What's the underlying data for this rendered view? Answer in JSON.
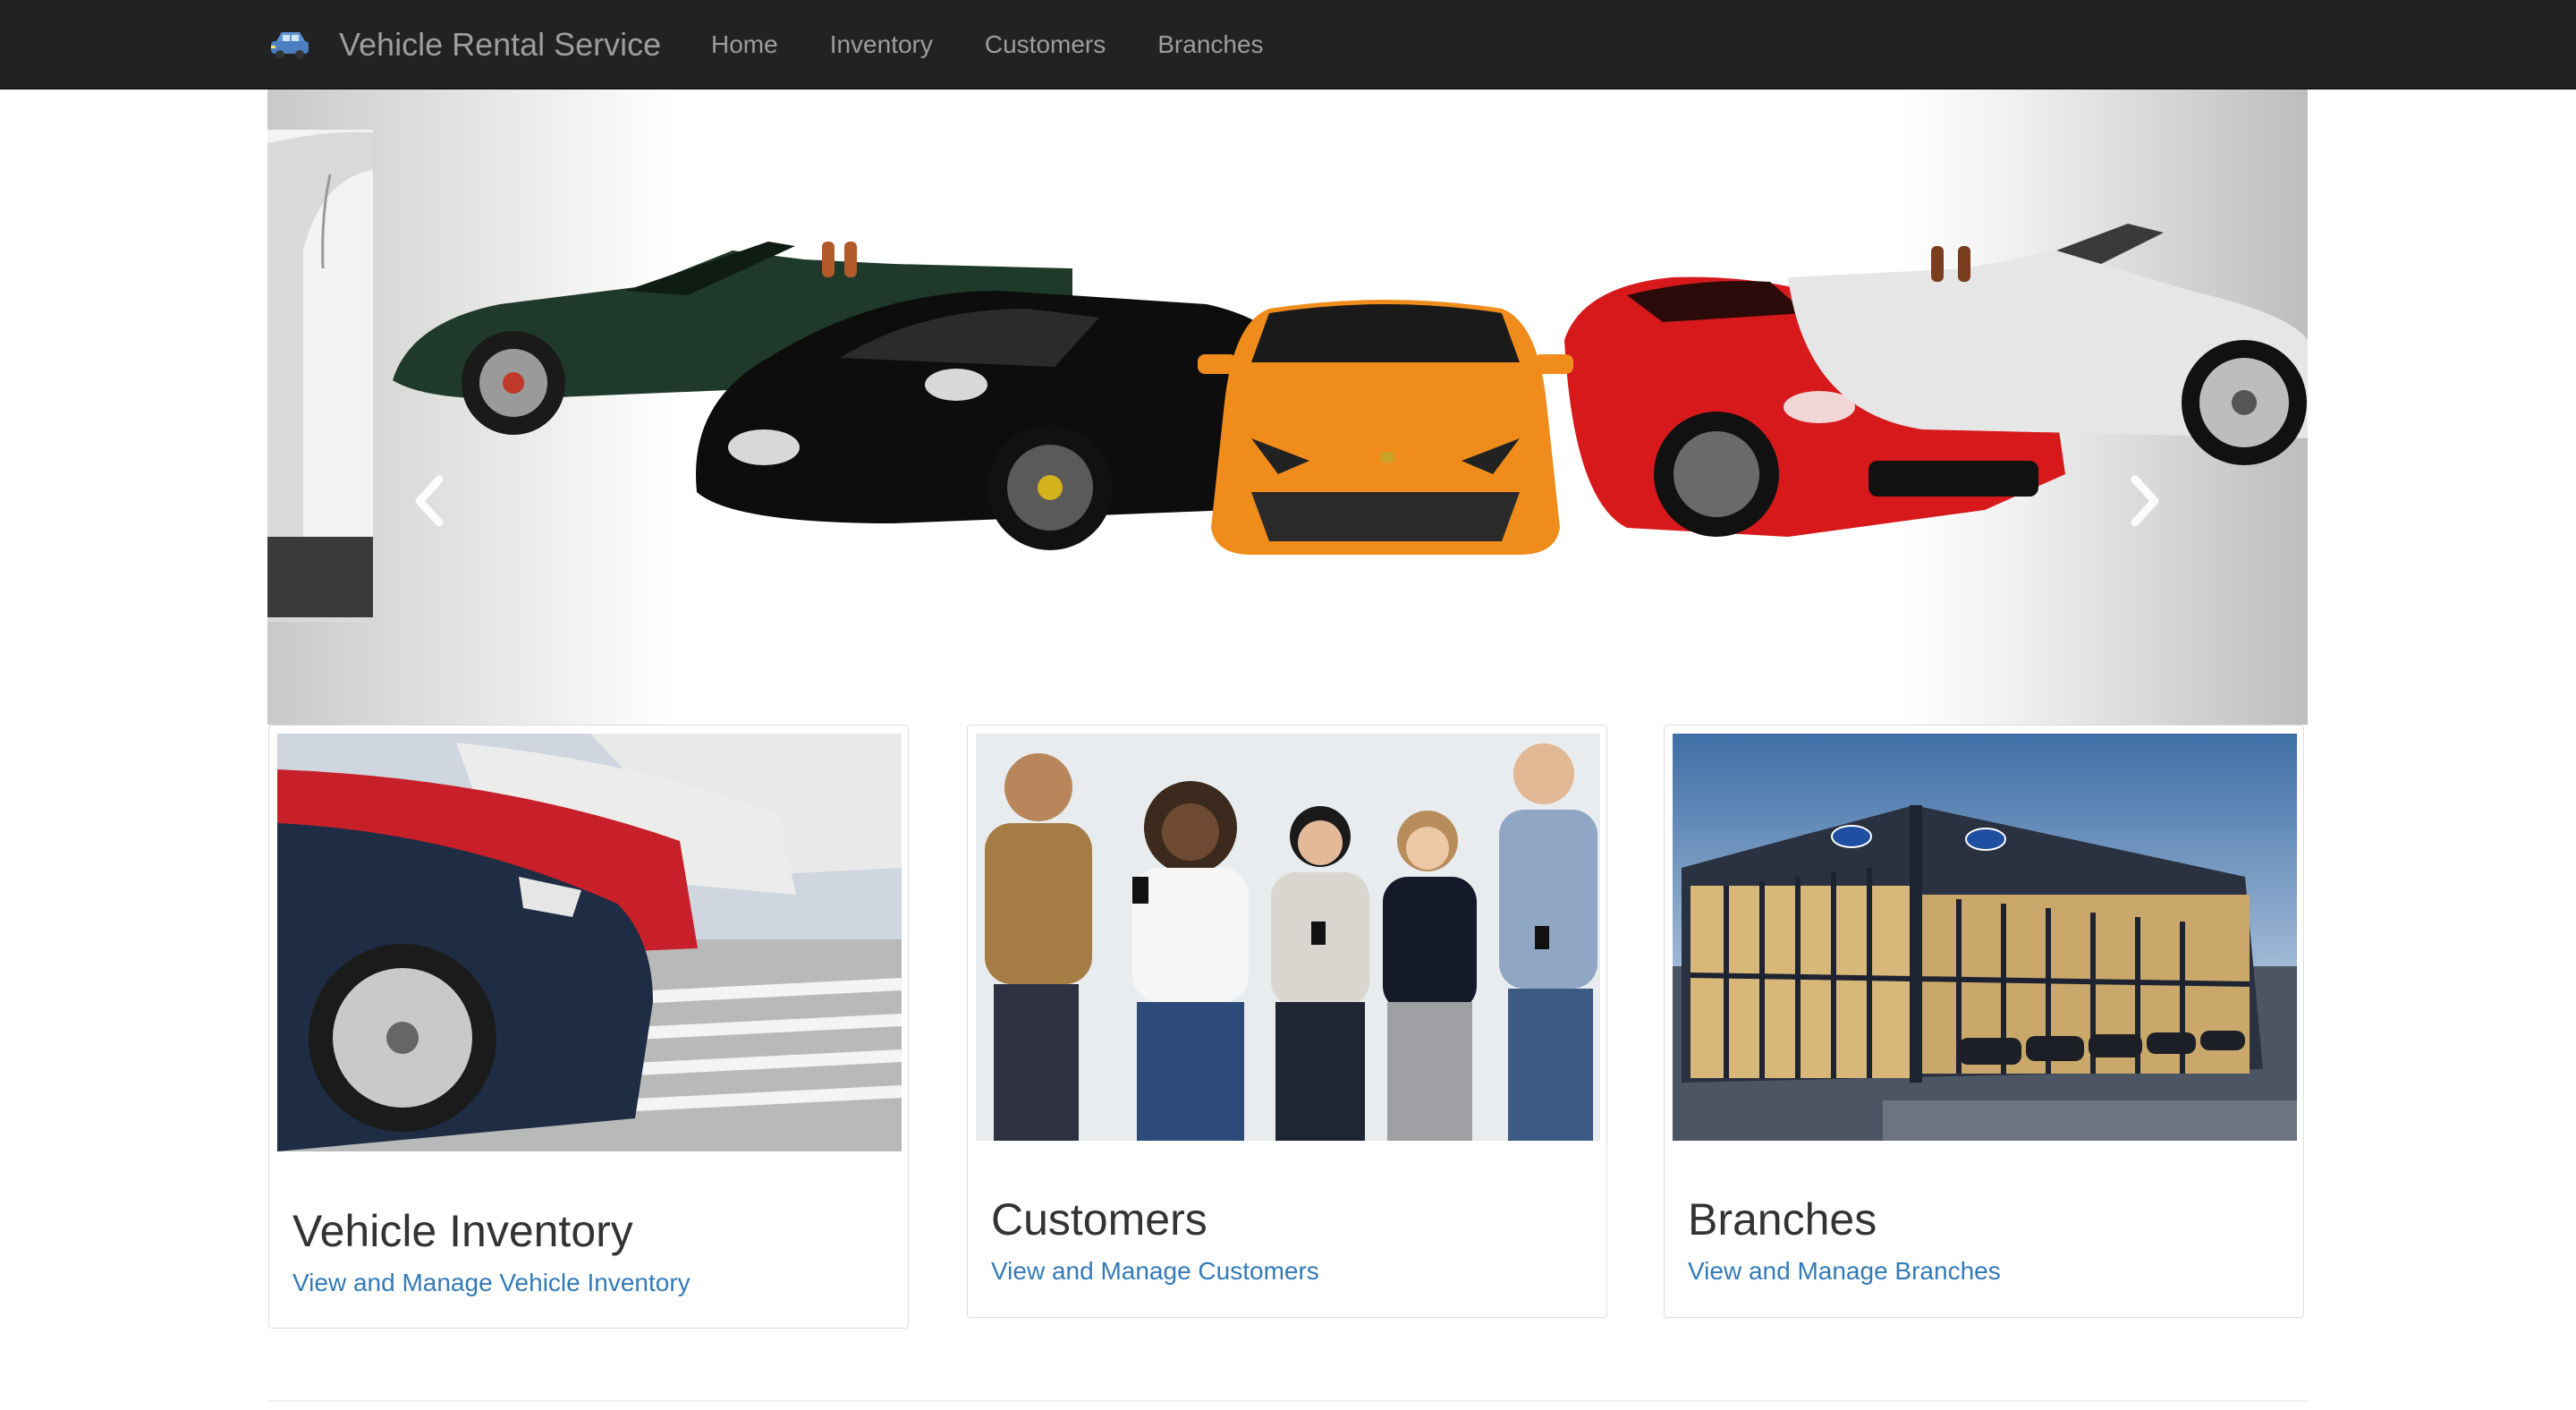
{
  "navbar": {
    "brand_icon": "car-icon",
    "brand": "Vehicle Rental Service",
    "items": [
      {
        "label": "Home"
      },
      {
        "label": "Inventory"
      },
      {
        "label": "Customers"
      },
      {
        "label": "Branches"
      }
    ]
  },
  "carousel": {
    "prev_icon": "chevron-left-icon",
    "next_icon": "chevron-right-icon",
    "car_colors": [
      "#1f3a2a",
      "#0d0d0d",
      "#f08c1c",
      "#d8191c",
      "#e6e6e6"
    ]
  },
  "cards": [
    {
      "title": "Vehicle Inventory",
      "link": "View and Manage Vehicle Inventory"
    },
    {
      "title": "Customers",
      "link": "View and Manage Customers"
    },
    {
      "title": "Branches",
      "link": "View and Manage Branches"
    }
  ],
  "colors": {
    "navbar_bg": "#222222",
    "nav_text": "#9d9d9d",
    "link": "#337ab7",
    "card_border": "#dddddd"
  }
}
